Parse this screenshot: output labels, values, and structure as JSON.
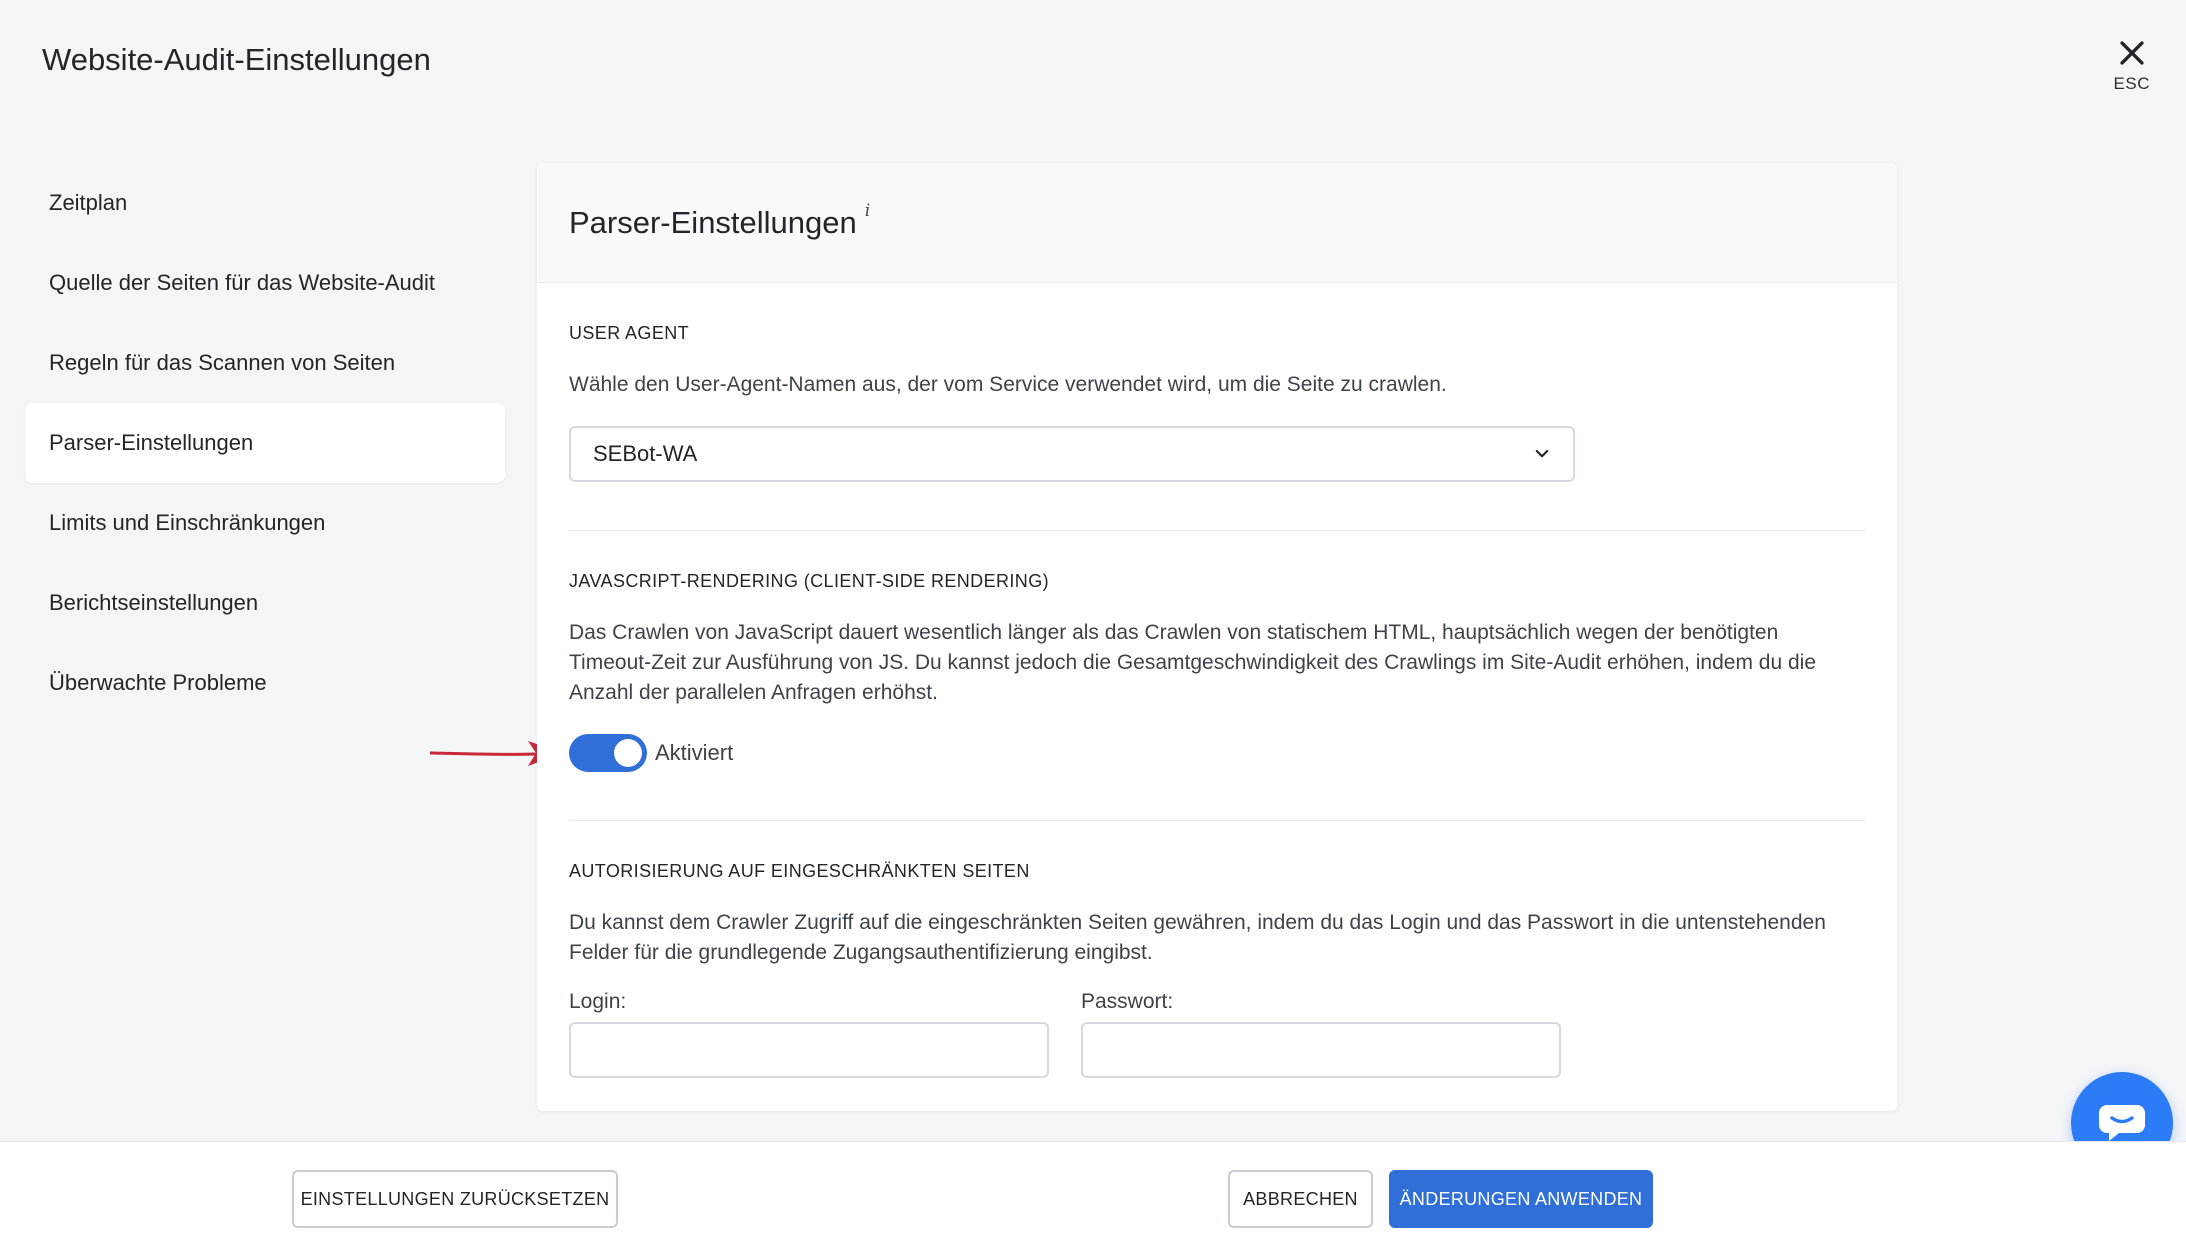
{
  "header": {
    "title": "Website-Audit-Einstellungen",
    "close_label": "ESC"
  },
  "sidebar": {
    "items": [
      {
        "label": "Zeitplan",
        "active": false
      },
      {
        "label": "Quelle der Seiten für das Website-Audit",
        "active": false
      },
      {
        "label": "Regeln für das Scannen von Seiten",
        "active": false
      },
      {
        "label": "Parser-Einstellungen",
        "active": true
      },
      {
        "label": "Limits und Einschränkungen",
        "active": false
      },
      {
        "label": "Berichtseinstellungen",
        "active": false
      },
      {
        "label": "Überwachte Probleme",
        "active": false
      }
    ]
  },
  "panel": {
    "title": "Parser-Einstellungen",
    "info_mark": "i",
    "user_agent": {
      "title": "USER AGENT",
      "description": "Wähle den User-Agent-Namen aus, der vom Service verwendet wird, um die Seite zu crawlen.",
      "selected": "SEBot-WA"
    },
    "js_rendering": {
      "title": "JAVASCRIPT-RENDERING (CLIENT-SIDE RENDERING)",
      "description": "Das Crawlen von JavaScript dauert wesentlich länger als das Crawlen von statischem HTML, hauptsächlich wegen der benötigten Timeout-Zeit zur Ausführung von JS. Du kannst jedoch die Gesamtgeschwindigkeit des Crawlings im Site-Audit erhöhen, indem du die Anzahl der parallelen Anfragen erhöhst.",
      "toggle_on": true,
      "toggle_label": "Aktiviert"
    },
    "auth": {
      "title": "AUTORISIERUNG AUF EINGESCHRÄNKTEN SEITEN",
      "description": "Du kannst dem Crawler Zugriff auf die eingeschränkten Seiten gewähren, indem du das Login und das Passwort in die untenstehenden Felder für die grundlegende Zugangsauthentifizierung eingibst.",
      "login_label": "Login:",
      "login_value": "",
      "password_label": "Passwort:",
      "password_value": ""
    }
  },
  "footer": {
    "reset_label": "EINSTELLUNGEN ZURÜCKSETZEN",
    "cancel_label": "ABBRECHEN",
    "apply_label": "ÄNDERUNGEN ANWENDEN"
  },
  "colors": {
    "accent": "#2f6fd7",
    "chat": "#2b7cf6",
    "arrow": "#c8283a"
  },
  "icons": {
    "close": "close-icon",
    "dropdown": "chevron-down-icon",
    "chat": "chat-icon",
    "annotation": "arrow-icon"
  }
}
